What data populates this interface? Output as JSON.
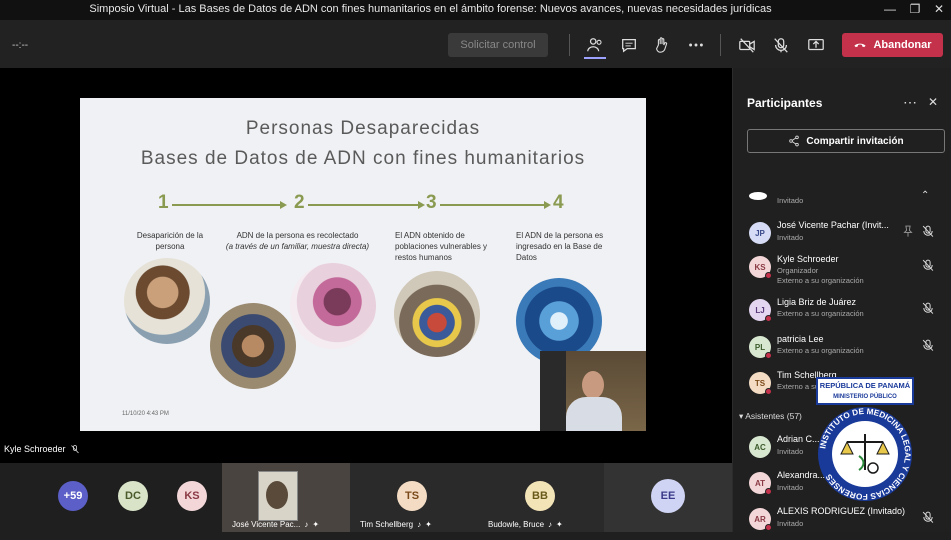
{
  "window": {
    "title": "Simposio Virtual - Las Bases de Datos de ADN con fines humanitarios en el ámbito forense: Nuevos avances, nuevas necesidades jurídicas"
  },
  "toolbar": {
    "timer": "--:--",
    "request_control_label": "Solicitar control",
    "leave_label": "Abandonar",
    "leave_color": "#c4314b"
  },
  "slide": {
    "title_line1": "Personas Desaparecidas",
    "title_line2": "Bases de Datos de ADN con fines humanitarios",
    "steps": [
      {
        "num": "1",
        "text": "Desaparición de la persona"
      },
      {
        "num": "2",
        "text": "ADN de la persona es recolectado",
        "note": "(a través de un familiar, muestra directa)"
      },
      {
        "num": "3",
        "text": "El ADN obtenido de poblaciones vulnerables y restos humanos"
      },
      {
        "num": "4",
        "text": "El ADN de la persona es ingresado en la Base de Datos"
      }
    ],
    "date": "11/10/20 4:43 PM",
    "accent_color": "#8a9a50"
  },
  "stage": {
    "presenter_name": "Kyle Schroeder"
  },
  "bottom_tiles": [
    {
      "initials": "+59",
      "color": "#5b5fc7"
    },
    {
      "initials": "DC",
      "color": "#d8e3c8",
      "text_color": "#4a5a2a"
    },
    {
      "initials": "KS",
      "color": "#f3d6d8",
      "text_color": "#8a3a44"
    },
    {
      "name": "José Vicente Pac..."
    },
    {
      "initials": "TS",
      "color": "#f4dcc4",
      "text_color": "#7a4a1a",
      "name": "Tim Schellberg"
    },
    {
      "initials": "BB",
      "color": "#f3e4b8",
      "text_color": "#6a5a1a",
      "name": "Budowle, Bruce"
    },
    {
      "initials": "EE",
      "color": "#d0d4f4",
      "text_color": "#3a3a8a"
    }
  ],
  "sidebar": {
    "title": "Participantes",
    "share_label": "Compartir invitación",
    "invited_label": "Invitado",
    "attendees_header": "Asistentes (57)",
    "participants": [
      {
        "initials": "JP",
        "name": "José Vicente Pachar (Invit...",
        "sub1": "Invitado",
        "color": "#d6dcf6",
        "text_color": "#3a4a8a"
      },
      {
        "initials": "KS",
        "name": "Kyle Schroeder",
        "sub1": "Organizador",
        "sub2": "Externo a su organización",
        "color": "#f3d6d8",
        "text_color": "#8a3a44"
      },
      {
        "initials": "LJ",
        "name": "Ligia Briz de Juárez",
        "sub1": "Externo a su organización",
        "color": "#e4d6f0",
        "text_color": "#5a3a7a"
      },
      {
        "initials": "PL",
        "name": "patricia Lee",
        "sub1": "Externo a su organización",
        "color": "#d8e8d0",
        "text_color": "#3a5a2a"
      },
      {
        "initials": "TS",
        "name": "Tim Schellberg",
        "sub1": "Externo a su organización",
        "color": "#f4dcc4",
        "text_color": "#7a4a1a"
      }
    ],
    "attendees": [
      {
        "initials": "AC",
        "name": "Adrian C...",
        "sub1": "Invitado",
        "color": "#d8e8d0",
        "text_color": "#3a5a2a"
      },
      {
        "initials": "AT",
        "name": "Alexandra...",
        "sub1": "Invitado",
        "color": "#f3d6d8",
        "text_color": "#8a3a44"
      },
      {
        "initials": "AR",
        "name": "ALEXIS RODRIGUEZ (Invitado)",
        "sub1": "Invitado",
        "color": "#f3d6d8",
        "text_color": "#8a3a44"
      }
    ]
  },
  "seal": {
    "top_text": "REPÚBLICA DE PANAMÁ",
    "sub_text": "MINISTERIO PÚBLICO",
    "ring_text": "INSTITUTO DE MEDICINA LEGAL Y CIENCIAS FORENSES"
  }
}
